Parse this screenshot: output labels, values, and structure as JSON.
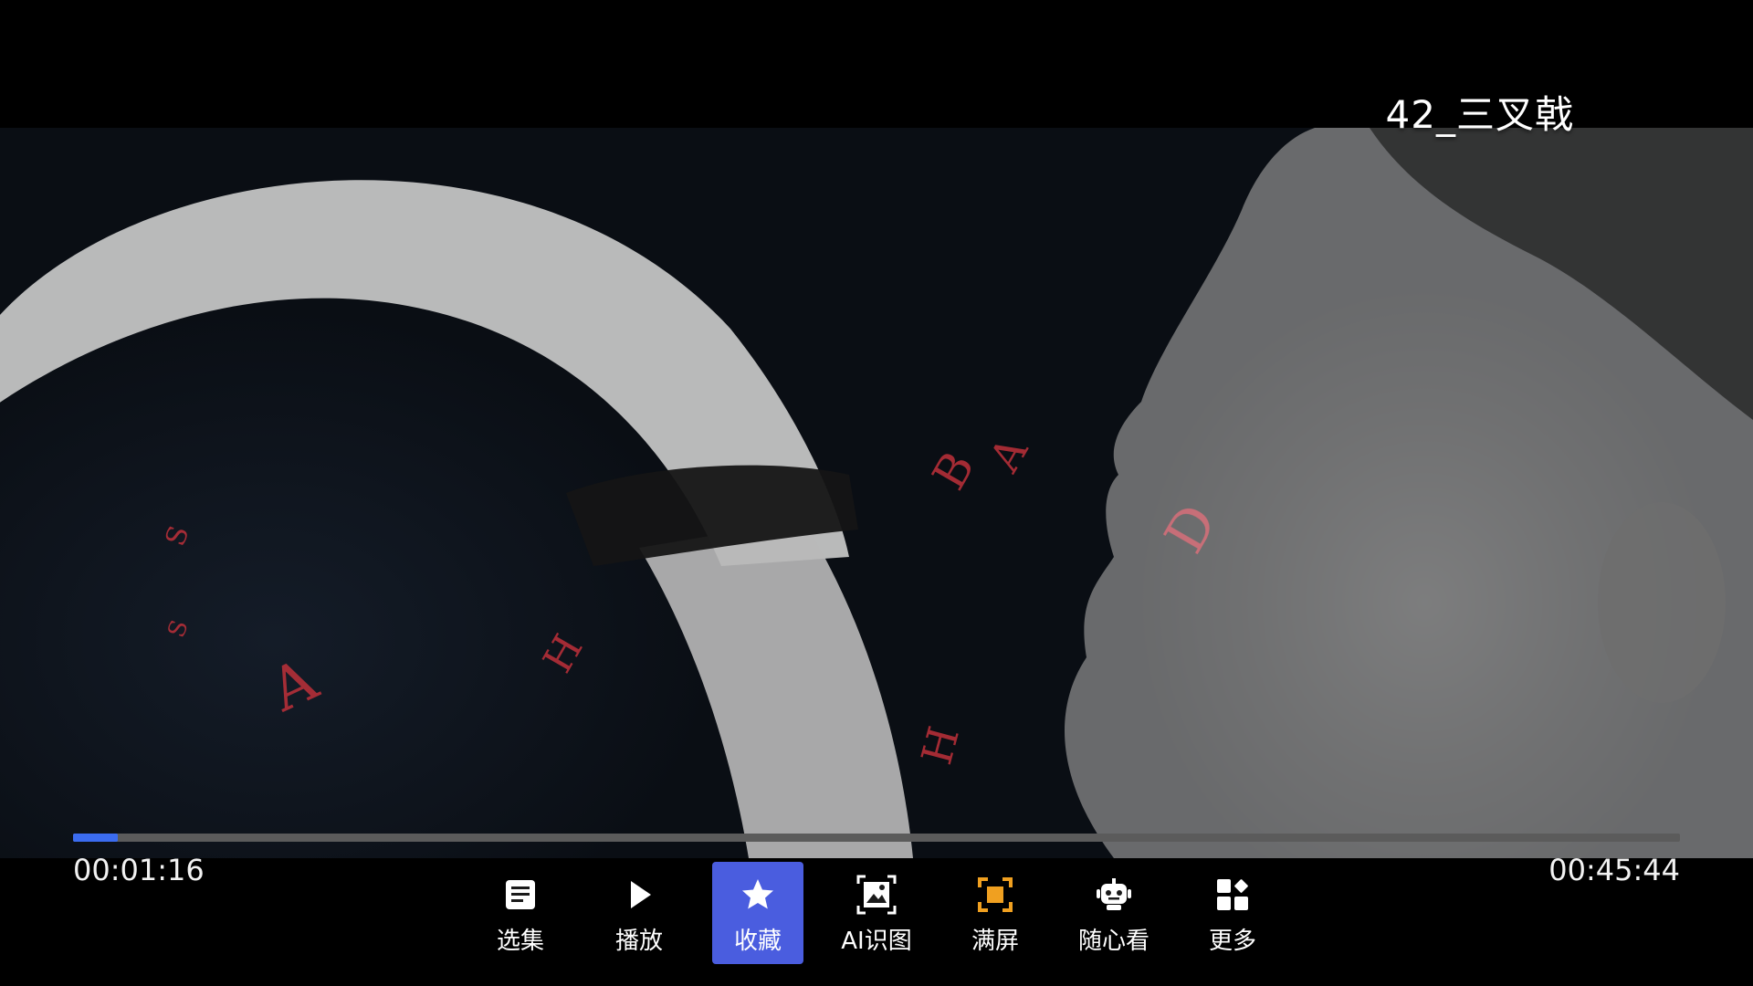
{
  "video": {
    "title": "42_三叉戟",
    "current_time": "00:01:16",
    "total_time": "00:45:44",
    "progress_fraction": 0.028
  },
  "controls": [
    {
      "id": "episodes",
      "label": "选集",
      "icon": "list-icon",
      "active": false
    },
    {
      "id": "play",
      "label": "播放",
      "icon": "play-icon",
      "active": false
    },
    {
      "id": "favorite",
      "label": "收藏",
      "icon": "star-icon",
      "active": true
    },
    {
      "id": "ai",
      "label": "AI识图",
      "icon": "image-scan-icon",
      "active": false
    },
    {
      "id": "fullscreen",
      "label": "满屏",
      "icon": "fullscreen-icon",
      "active": false
    },
    {
      "id": "random",
      "label": "随心看",
      "icon": "robot-icon",
      "active": false
    },
    {
      "id": "more",
      "label": "更多",
      "icon": "grid-more-icon",
      "active": false
    }
  ],
  "colors": {
    "accent": "#3b6cf0",
    "active_button": "#4a5ddf",
    "fullscreen_icon": "#f0a020",
    "track": "#5b5b5b"
  }
}
